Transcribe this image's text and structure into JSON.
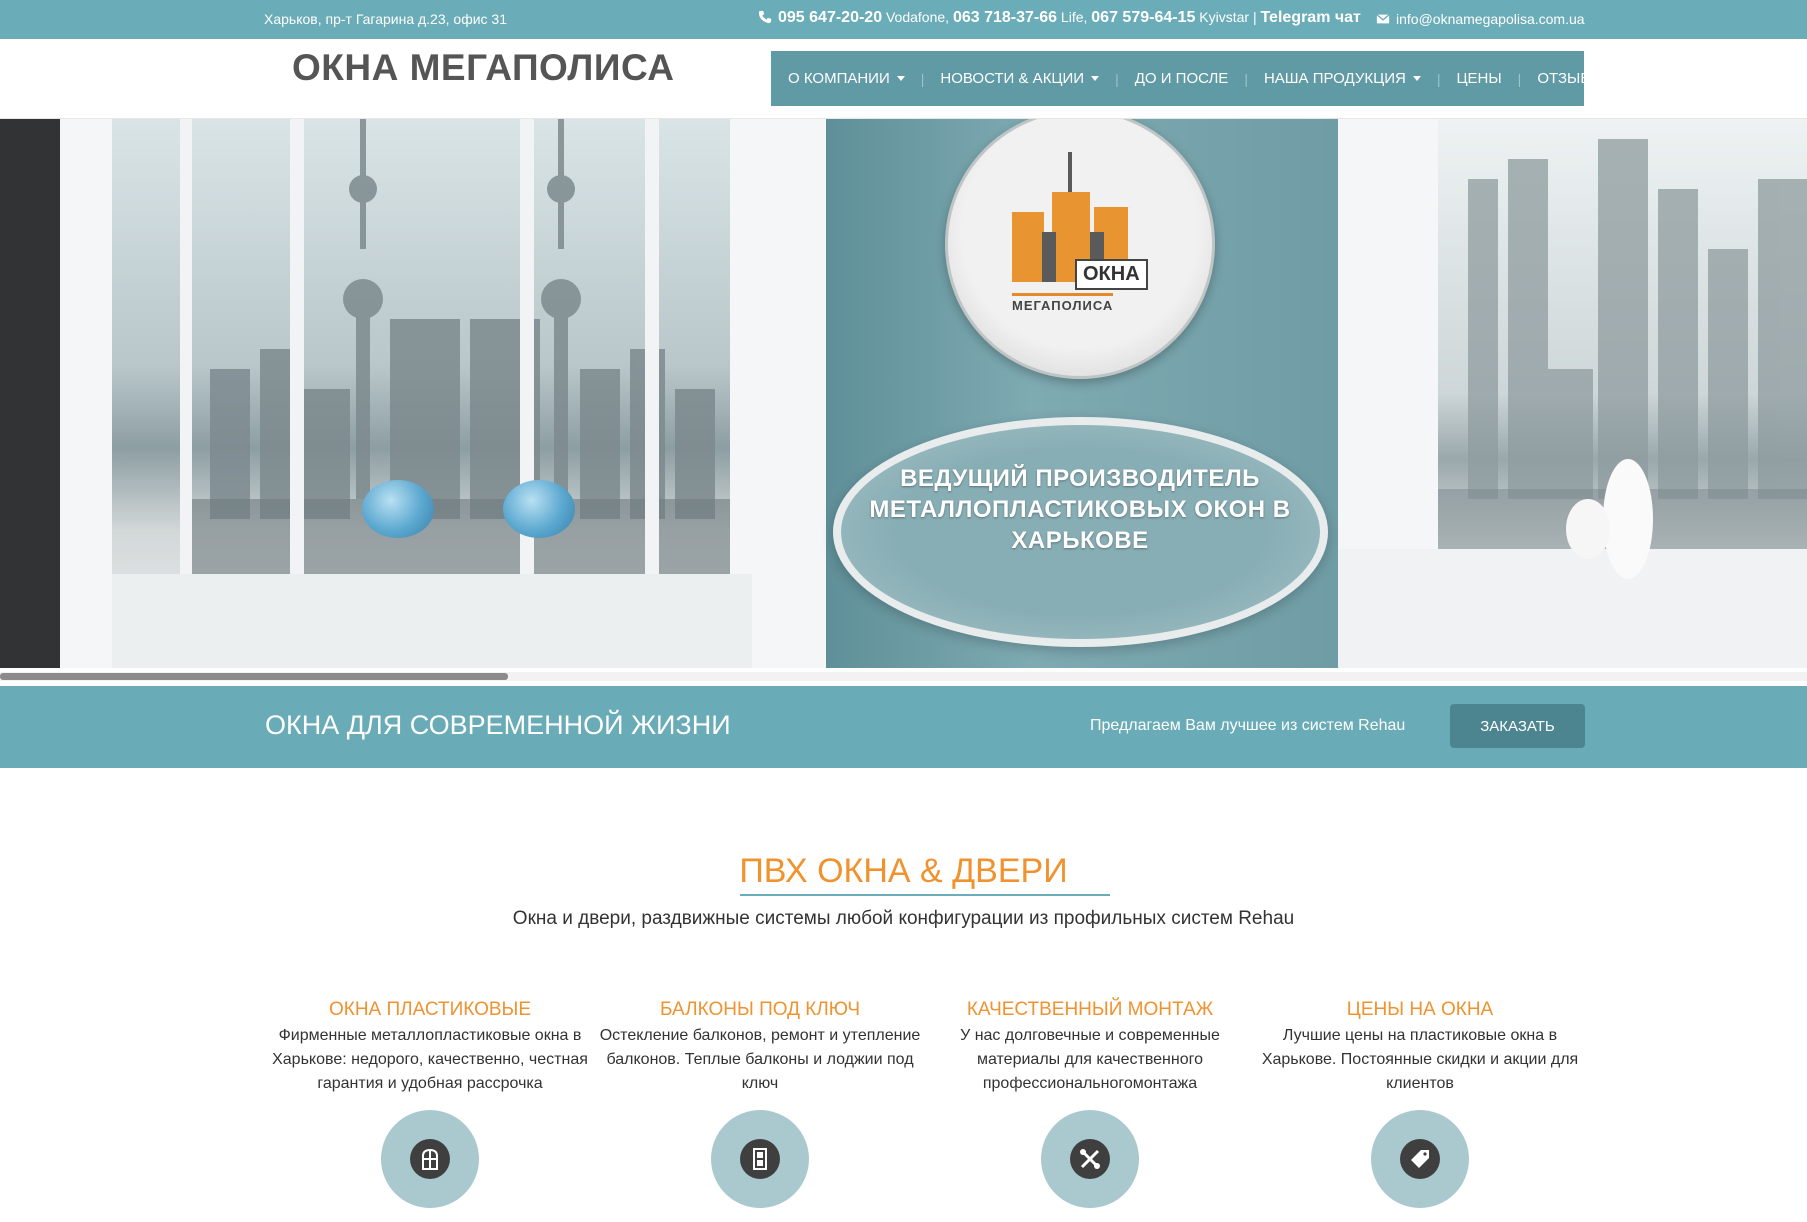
{
  "topbar": {
    "address": "Харьков, пр-т Гагарина д.23, офис 31",
    "phone1": "095 647-20-20",
    "op1": " Vodafone, ",
    "phone2": "063 718-37-66",
    "op2": " Life, ",
    "phone3": "067 579-64-15",
    "op3": " Kyivstar | ",
    "telegram": "Telegram чат",
    "email": "info@oknamegapolisa.com.ua"
  },
  "header": {
    "brand": "ОКНА МЕГАПОЛИСА",
    "nav": [
      {
        "label": "О КОМПАНИИ"
      },
      {
        "label": "НОВОСТИ & АКЦИИ"
      },
      {
        "label": "ДО И ПОСЛЕ"
      },
      {
        "label": "НАША ПРОДУКЦИЯ"
      },
      {
        "label": "ЦЕНЫ"
      },
      {
        "label": "ОТЗЫВЫ"
      }
    ],
    "sep": "|"
  },
  "hero": {
    "logo_tag": "ОКНА",
    "logo_sub": "МЕГАПОЛИСА",
    "tagline": "ВЕДУЩИЙ ПРОИЗВОДИТЕЛЬ МЕТАЛЛОПЛАСТИКОВЫХ ОКОН В ХАРЬКОВЕ"
  },
  "band": {
    "title": "ОКНА ДЛЯ СОВРЕМЕННОЙ ЖИЗНИ",
    "subtitle": "Предлагаем Вам лучшее из систем Rehau",
    "button": "ЗАКАЗАТЬ"
  },
  "section": {
    "title": "ПВХ ОКНА & ДВЕРИ",
    "subtitle": "Окна и двери, раздвижные системы любой конфигурации из профильных систем Rehau"
  },
  "features": [
    {
      "title": "ОКНА ПЛАСТИКОВЫЕ",
      "text": "Фирменные металлопластиковые окна в Харькове: недорого, качественно, честная гарантия и удобная рассрочка",
      "icon": "window-icon"
    },
    {
      "title": "БАЛКОНЫ ПОД КЛЮЧ",
      "text": "Остекление балконов, ремонт и утепление балконов. Теплые балконы и лоджии под ключ",
      "icon": "balcony-door-icon"
    },
    {
      "title": "КАЧЕСТВЕННЫЙ МОНТАЖ",
      "text": "У нас долговечные и современные материалы для качественного профессиональногомонтажа",
      "icon": "tools-icon"
    },
    {
      "title": "ЦЕНЫ НА ОКНА",
      "text": "Лучшие цены на пластиковые окна в Харькове. Постоянные скидки и акции для клиентов",
      "icon": "price-tag-icon"
    }
  ],
  "colors": {
    "accent": "#6aacb7",
    "orange": "#f0922e",
    "nav": "#5f9aa5"
  }
}
